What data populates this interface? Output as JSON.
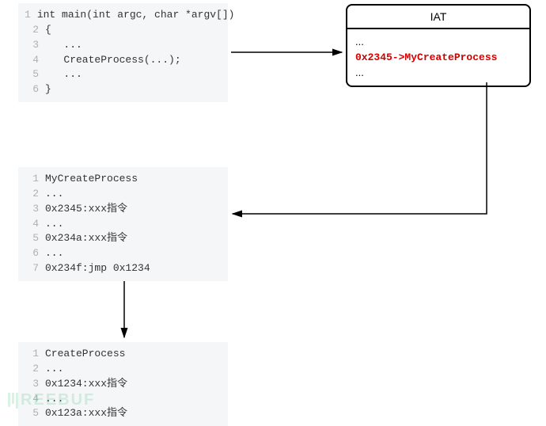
{
  "code_block1": {
    "lines": [
      "int main(int argc, char *argv[])",
      "{",
      "   ...",
      "   CreateProcess(...);",
      "   ...",
      "}"
    ]
  },
  "iat": {
    "title": "IAT",
    "rows": [
      "...",
      "0x2345->MyCreateProcess",
      "..."
    ]
  },
  "code_block2": {
    "lines": [
      "MyCreateProcess",
      "...",
      "0x2345:xxx指令",
      "...",
      "0x234a:xxx指令",
      "...",
      "0x234f:jmp 0x1234"
    ]
  },
  "code_block3": {
    "lines": [
      "CreateProcess",
      "...",
      "0x1234:xxx指令",
      "...",
      "0x123a:xxx指令"
    ]
  },
  "watermark": "REEBUF"
}
